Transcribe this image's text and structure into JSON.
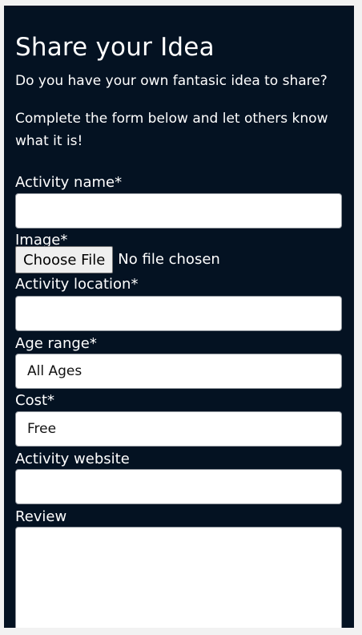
{
  "form": {
    "title": "Share your Idea",
    "intro": "Do you have your own fantasic idea to share?",
    "instructions": "Complete the form below and let others know what it is!",
    "fields": {
      "activity_name": {
        "label": "Activity name*",
        "value": ""
      },
      "image": {
        "label": "Image*",
        "button_label": "Choose File",
        "status": "No file chosen"
      },
      "activity_location": {
        "label": "Activity location*",
        "value": ""
      },
      "age_range": {
        "label": "Age range*",
        "selected": "All Ages"
      },
      "cost": {
        "label": "Cost*",
        "selected": "Free"
      },
      "activity_website": {
        "label": "Activity website",
        "value": ""
      },
      "review": {
        "label": "Review",
        "value": ""
      }
    }
  }
}
